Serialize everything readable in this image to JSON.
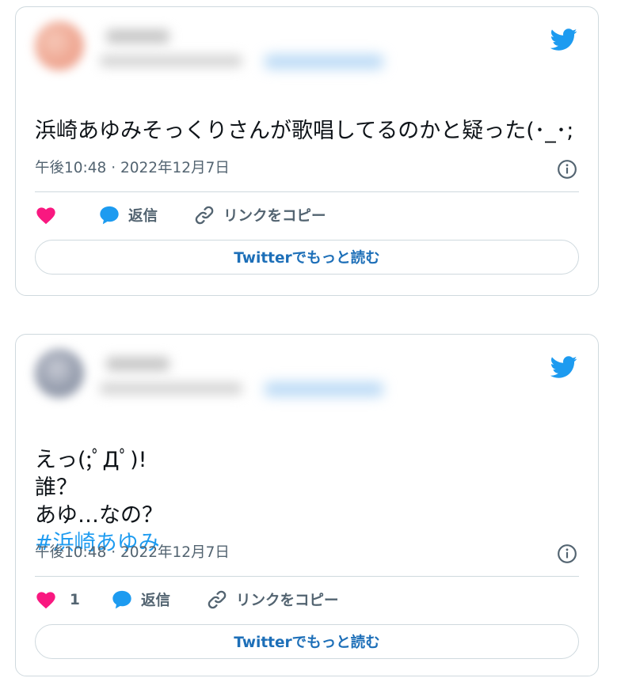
{
  "tweets": [
    {
      "text": "浜崎あゆみそっくりさんが歌唱してるのかと疑った(･_･;",
      "hashtag": "",
      "timestamp": "午後10:48 · 2022年12月7日",
      "like_count": "",
      "reply_label": "返信",
      "copy_link_label": "リンクをコピー",
      "read_more_label": "Twitterでもっと読む"
    },
    {
      "text": "えっ(;ﾟДﾟ)!\n誰？\nあゆ…なの？",
      "hashtag": "#浜崎あゆみ",
      "timestamp": "午後10:48 · 2022年12月7日",
      "like_count": "1",
      "reply_label": "返信",
      "copy_link_label": "リンクをコピー",
      "read_more_label": "Twitterでもっと読む"
    }
  ],
  "colors": {
    "twitter_blue": "#1d9bf0",
    "heart_pink": "#f91880",
    "muted_text": "#536471",
    "border": "#cfd9de"
  },
  "icons": [
    "twitter-bird-icon",
    "info-icon",
    "heart-icon",
    "reply-bubble-icon",
    "link-icon"
  ]
}
